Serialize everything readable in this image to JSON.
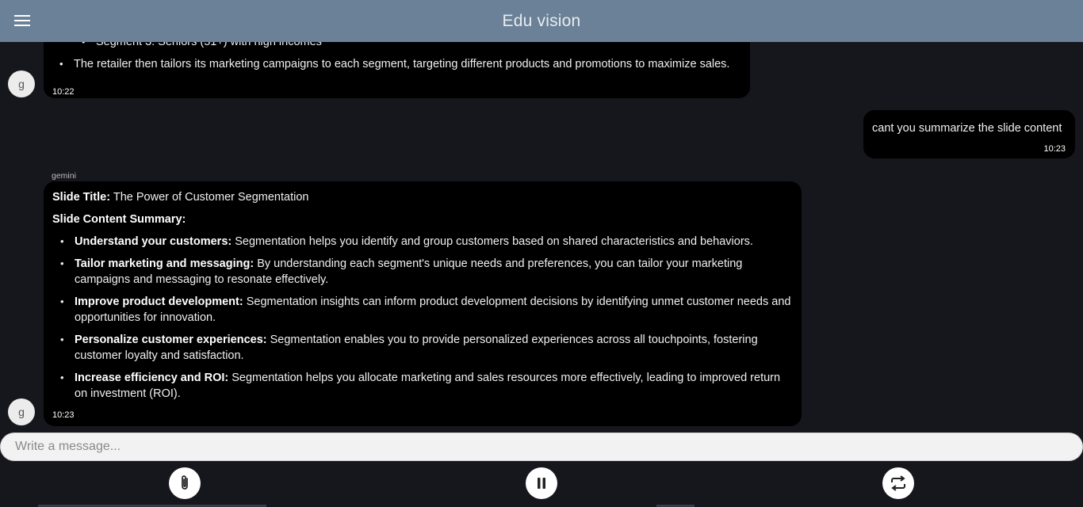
{
  "header": {
    "title": "Edu vision",
    "menu_icon": "menu-icon"
  },
  "messages": [
    {
      "role": "bot",
      "avatar": "g",
      "time": "10:22",
      "items": [
        {
          "level": 2,
          "text": "Segment 3: Seniors (51+) with high incomes"
        },
        {
          "level": 1,
          "text": "The retailer then tailors its marketing campaigns to each segment, targeting different products and promotions to maximize sales."
        }
      ]
    },
    {
      "role": "user",
      "text": "cant you summarize the slide content",
      "time": "10:23"
    },
    {
      "role": "bot",
      "sender": "gemini",
      "avatar": "g",
      "time": "10:23",
      "title_label": "Slide Title:",
      "title_value": "The Power of Customer Segmentation",
      "summary_label": "Slide Content Summary:",
      "points": [
        {
          "label": "Understand your customers:",
          "text": "Segmentation helps you identify and group customers based on shared characteristics and behaviors."
        },
        {
          "label": "Tailor marketing and messaging:",
          "text": "By understanding each  segment's unique needs and preferences, you can tailor your marketing campaigns and messaging to resonate effectively."
        },
        {
          "label": "Improve product development:",
          "text": "Segmentation insights can inform product development decisions by identifying unmet customer needs and opportunities for innovation."
        },
        {
          "label": "Personalize customer experiences:",
          "text": "Segmentation enables you to provide personalized experiences across all touchpoints,  fostering customer loyalty and satisfaction."
        },
        {
          "label": "Increase efficiency and ROI:",
          "text": "Segmentation helps you allocate marketing and sales resources more effectively, leading to improved return on investment (ROI)."
        }
      ]
    }
  ],
  "composer": {
    "placeholder": "Write a message..."
  },
  "controls": {
    "attach_icon": "paperclip-icon",
    "pause_icon": "pause-icon",
    "repeat_icon": "repeat-icon"
  }
}
